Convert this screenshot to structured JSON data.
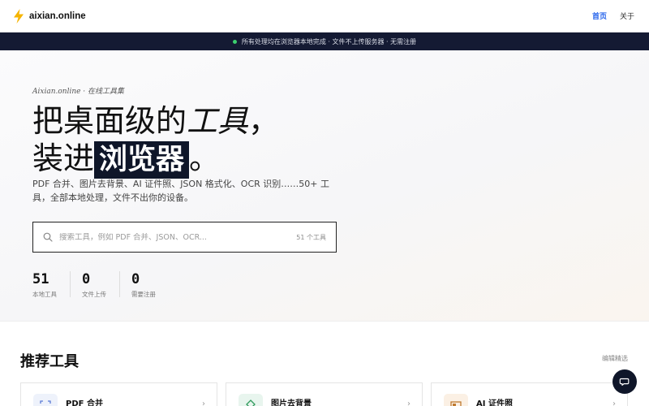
{
  "header": {
    "brand": "aixian.online",
    "nav": [
      {
        "label": "首页",
        "active": true
      },
      {
        "label": "关于",
        "active": false
      }
    ]
  },
  "announcement": {
    "text": "所有处理均在浏览器本地完成 · 文件不上传服务器 · 无需注册"
  },
  "hero": {
    "kicker": "Aixian.online · 在线工具集",
    "headline_line1_a": "把桌面级的",
    "headline_line1_b": "工具",
    "headline_line1_c": "，",
    "headline_line2_a": "装进",
    "headline_line2_highlight": "浏览器",
    "headline_line2_c": "。",
    "description": "PDF 合并、图片去背景、AI 证件照、JSON 格式化、OCR 识别……50+ 工具，全部本地处理，文件不出你的设备。",
    "search": {
      "placeholder": "搜索工具，例如 PDF 合并、JSON、OCR...",
      "count": "51 个工具"
    },
    "stats": [
      {
        "value": "51",
        "label": "本地工具"
      },
      {
        "value": "0",
        "label": "文件上传"
      },
      {
        "value": "0",
        "label": "需要注册"
      }
    ]
  },
  "featured": {
    "title": "推荐工具",
    "edit_link": "编辑精选",
    "cards": [
      {
        "name": "PDF 合并",
        "icon": "pdf-merge-icon",
        "color": "blue"
      },
      {
        "name": "图片去背景",
        "icon": "image-bg-remove-icon",
        "color": "green"
      },
      {
        "name": "AI 证件照",
        "icon": "id-photo-icon",
        "color": "orange"
      }
    ]
  },
  "colors": {
    "accent": "#2563eb",
    "dark": "#0f1629",
    "announce_dot": "#3ccf6e"
  }
}
